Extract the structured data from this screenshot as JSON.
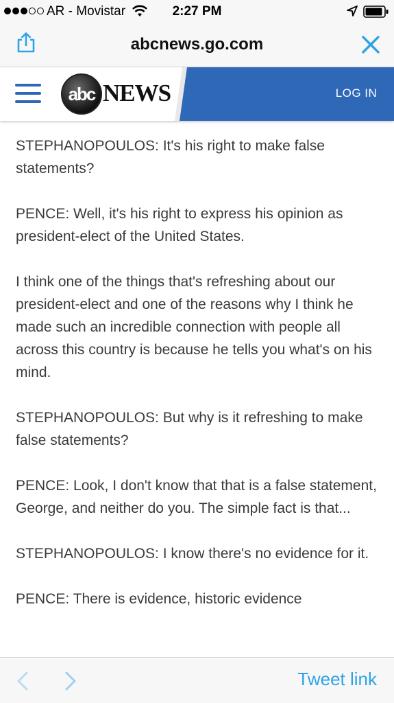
{
  "status_bar": {
    "carrier": "AR - Movistar",
    "time": "2:27 PM",
    "signal_dots_filled": 3,
    "signal_dots_total": 5,
    "icons": [
      "wifi-icon",
      "location-icon",
      "battery-icon"
    ]
  },
  "browser": {
    "url": "abcnews.go.com",
    "icons": [
      "share-icon",
      "close-icon"
    ],
    "accent_color": "#2fa3e6"
  },
  "site_header": {
    "logo_text": "abc",
    "wordmark": "NEWS",
    "login_label": "LOG IN",
    "brand_color": "#3068b8",
    "icons": [
      "menu-icon"
    ]
  },
  "article": {
    "paragraphs": [
      "STEPHANOPOULOS: It's his right to make false statements?",
      "PENCE: Well, it's his right to express his opinion as president-elect of the United States.",
      "I think one of the things that's refreshing about our president-elect and one of the reasons why I think he made such an incredible connection with people all across this country is because he tells you what's on his mind.",
      "STEPHANOPOULOS: But why is it refreshing to make false statements?",
      "PENCE: Look, I don't know that that is a false statement, George, and neither do you. The simple fact is that...",
      "STEPHANOPOULOS: I know there's no evidence for it.",
      "PENCE: There is evidence, historic evidence"
    ]
  },
  "bottom_bar": {
    "tweet_link_label": "Tweet link",
    "icons": [
      "back-icon",
      "forward-icon"
    ]
  }
}
